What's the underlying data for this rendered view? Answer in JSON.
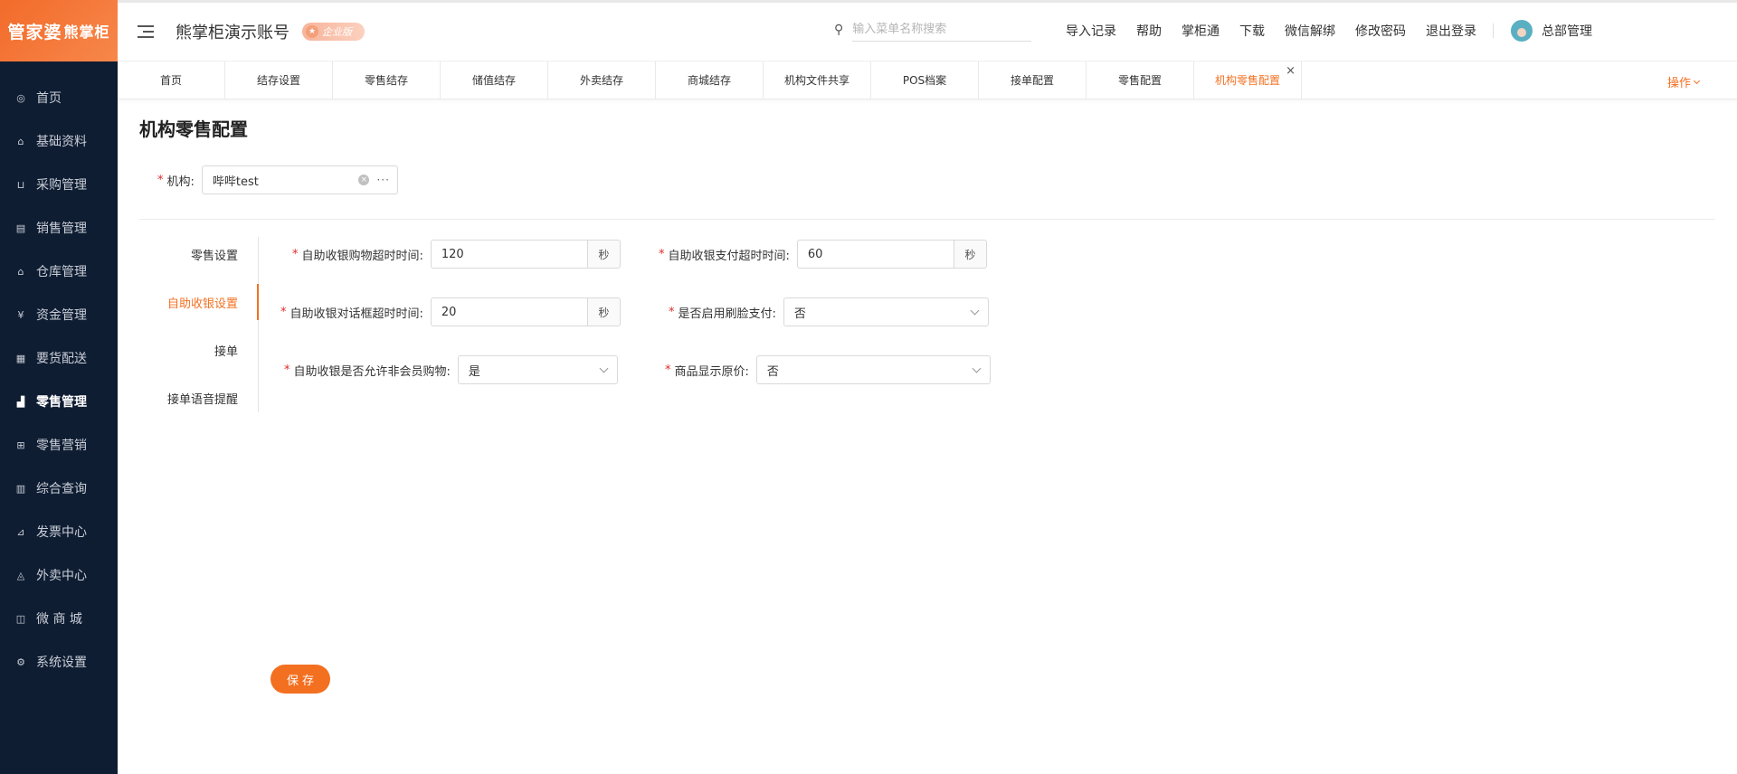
{
  "logo": {
    "main": "管家婆",
    "sub": "熊掌柜"
  },
  "sidebar": {
    "items": [
      {
        "label": "首页",
        "icon": "globe-icon",
        "glyph": "◎"
      },
      {
        "label": "基础资料",
        "icon": "home-icon",
        "glyph": "⌂"
      },
      {
        "label": "采购管理",
        "icon": "cart-icon",
        "glyph": "⊔"
      },
      {
        "label": "销售管理",
        "icon": "calendar-icon",
        "glyph": "▤"
      },
      {
        "label": "仓库管理",
        "icon": "warehouse-icon",
        "glyph": "⌂"
      },
      {
        "label": "资金管理",
        "icon": "money-icon",
        "glyph": "¥"
      },
      {
        "label": "要货配送",
        "icon": "document-icon",
        "glyph": "▦"
      },
      {
        "label": "零售管理",
        "icon": "chart-icon",
        "glyph": "▟"
      },
      {
        "label": "零售营销",
        "icon": "gift-icon",
        "glyph": "⊞"
      },
      {
        "label": "综合查询",
        "icon": "bar-chart-icon",
        "glyph": "▥"
      },
      {
        "label": "发票中心",
        "icon": "trend-icon",
        "glyph": "⊿"
      },
      {
        "label": "外卖中心",
        "icon": "alarm-icon",
        "glyph": "◬"
      },
      {
        "label": "微 商 城",
        "icon": "bag-icon",
        "glyph": "◫"
      },
      {
        "label": "系统设置",
        "icon": "gear-icon",
        "glyph": "⚙"
      }
    ],
    "active_index": 7
  },
  "header": {
    "account_title": "熊掌柜演示账号",
    "edition": "企业版",
    "search_placeholder": "输入菜单名称搜索",
    "links": [
      "导入记录",
      "帮助",
      "掌柜通",
      "下载",
      "微信解绑",
      "修改密码",
      "退出登录"
    ],
    "user_name": "总部管理"
  },
  "tabs": {
    "items": [
      "首页",
      "结存设置",
      "零售结存",
      "储值结存",
      "外卖结存",
      "商城结存",
      "机构文件共享",
      "POS档案",
      "接单配置",
      "零售配置",
      "机构零售配置"
    ],
    "active_index": 10,
    "actions_label": "操作",
    "close_glyph": "×"
  },
  "page": {
    "title": "机构零售配置",
    "org_label": "机构:",
    "org_value": "哔哔test"
  },
  "side_tabs": [
    "零售设置",
    "自助收银设置",
    "接单",
    "接单语音提醒"
  ],
  "form": {
    "shopping_timeout": {
      "label": "自助收银购物超时时间:",
      "value": "120",
      "unit": "秒"
    },
    "payment_timeout": {
      "label": "自助收银支付超时时间:",
      "value": "60",
      "unit": "秒"
    },
    "dialog_timeout": {
      "label": "自助收银对话框超时时间:",
      "value": "20",
      "unit": "秒"
    },
    "face_pay": {
      "label": "是否启用刷脸支付:",
      "value": "否"
    },
    "non_member": {
      "label": "自助收银是否允许非会员购物:",
      "value": "是"
    },
    "show_original_price": {
      "label": "商品显示原价:",
      "value": "否"
    },
    "required_mark": "*"
  },
  "save_label": "保存",
  "colors": {
    "accent": "#f37021",
    "sidebar_bg": "#0f1d33",
    "required": "#e02b2b"
  }
}
